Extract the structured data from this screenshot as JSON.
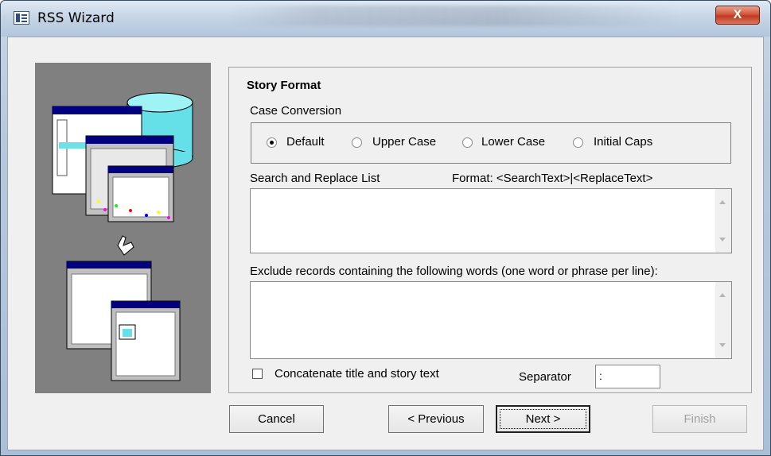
{
  "window": {
    "title": "RSS Wizard",
    "icon": "app-window-icon",
    "close_label": "X"
  },
  "section": {
    "title": "Story Format",
    "case_conversion_label": "Case Conversion",
    "case_options": [
      {
        "label": "Default",
        "checked": true
      },
      {
        "label": "Upper Case",
        "checked": false
      },
      {
        "label": "Lower Case",
        "checked": false
      },
      {
        "label": "Initial Caps",
        "checked": false
      }
    ],
    "search_replace_label": "Search and Replace List",
    "search_replace_format": "Format:  <SearchText>|<ReplaceText>",
    "search_replace_value": "",
    "exclude_label": "Exclude records containing the following words (one word or phrase per line):",
    "exclude_value": "",
    "concatenate_label": "Concatenate title and story text",
    "concatenate_checked": false,
    "separator_label": "Separator",
    "separator_value": ":"
  },
  "buttons": {
    "cancel": "Cancel",
    "previous": "< Previous",
    "next": "Next >",
    "finish": "Finish"
  }
}
